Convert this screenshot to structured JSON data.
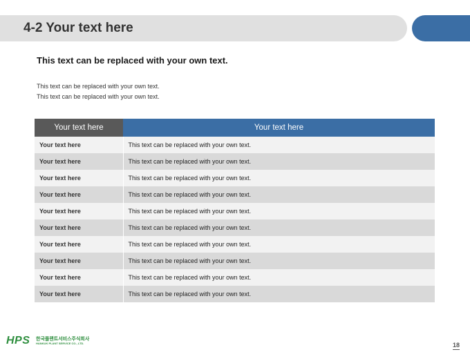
{
  "header": {
    "title": "4-2 Your text here"
  },
  "subtitle": "This text can be replaced with your own text.",
  "intro_lines": [
    "This text can be replaced with your own text.",
    "This text can be replaced with your own text."
  ],
  "table": {
    "headers": [
      "Your text here",
      "Your text here"
    ],
    "rows": [
      [
        "Your text here",
        "This text can be replaced with your own text."
      ],
      [
        "Your text here",
        "This text can be replaced with your own text."
      ],
      [
        "Your text here",
        "This text can be replaced with your own text."
      ],
      [
        "Your text here",
        "This text can be replaced with your own text."
      ],
      [
        "Your text here",
        "This text can be replaced with your own text."
      ],
      [
        "Your text here",
        "This text can be replaced with your own text."
      ],
      [
        "Your text here",
        "This text can be replaced with your own text."
      ],
      [
        "Your text here",
        "This text can be replaced with your own text."
      ],
      [
        "Your text here",
        "This text can be replaced with your own text."
      ],
      [
        "Your text here",
        "This text can be replaced with your own text."
      ]
    ]
  },
  "footer": {
    "logo_mark": "HPS",
    "company_kr": "한국플랜트서비스주식회사",
    "company_en": "HANKUK PLANT SERVICE CO., LTD.",
    "page_number": "18"
  },
  "colors": {
    "accent_blue": "#3b6ea5",
    "header_gray": "#595959",
    "title_bar": "#e0e0e0",
    "row_light": "#f2f2f2",
    "row_dark": "#d9d9d9",
    "logo_green": "#2f8f3f"
  }
}
